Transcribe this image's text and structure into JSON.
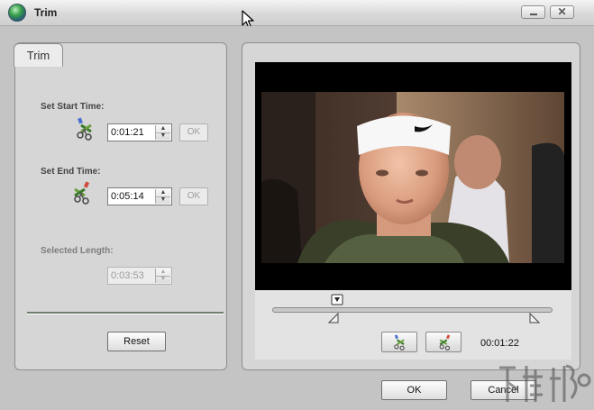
{
  "window": {
    "title": "Trim",
    "minimize_icon": "minimize-icon",
    "close_icon": "close-icon",
    "close_glyph": "✕"
  },
  "trim_tab": {
    "label": "Trim"
  },
  "start": {
    "label": "Set Start Time:",
    "value": "0:01:21",
    "ok_label": "OK",
    "icon": "scissors-start-icon"
  },
  "end": {
    "label": "Set End Time:",
    "value": "0:05:14",
    "ok_label": "OK",
    "icon": "scissors-end-icon"
  },
  "length": {
    "label": "Selected Length:",
    "value": "0:03:53"
  },
  "reset_label": "Reset",
  "player": {
    "current_time": "00:01:22",
    "slider_position": 0.23,
    "start_marker": 0.22,
    "end_marker": 0.935
  },
  "footer": {
    "ok_label": "OK",
    "cancel_label": "Cancel"
  },
  "colors": {
    "window_bg": "#c4c4c4",
    "panel_bg": "#d6d6d6",
    "video_bg": "#000000"
  }
}
